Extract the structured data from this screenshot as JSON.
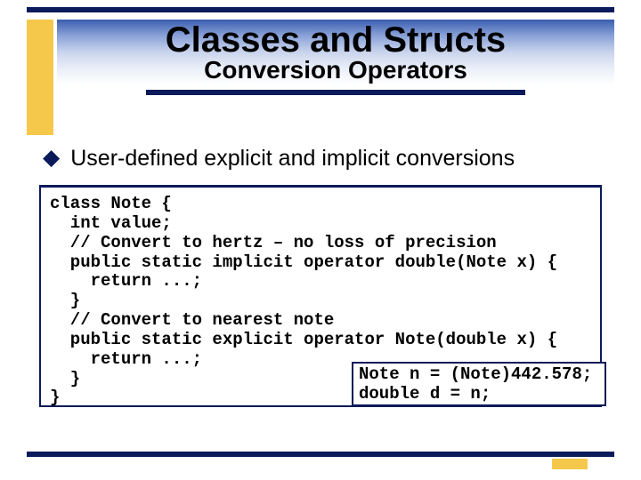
{
  "title": {
    "main": "Classes and Structs",
    "sub": "Conversion Operators"
  },
  "bullet": {
    "marker": "◆",
    "text": "User-defined explicit and implicit conversions"
  },
  "code": {
    "body": "class Note {\n  int value;\n  // Convert to hertz – no loss of precision\n  public static implicit operator double(Note x) {\n    return ...;\n  }\n  // Convert to nearest note\n  public static explicit operator Note(double x) {\n    return ...;\n  }\n}",
    "usage": "Note n = (Note)442.578;\ndouble d = n;"
  }
}
